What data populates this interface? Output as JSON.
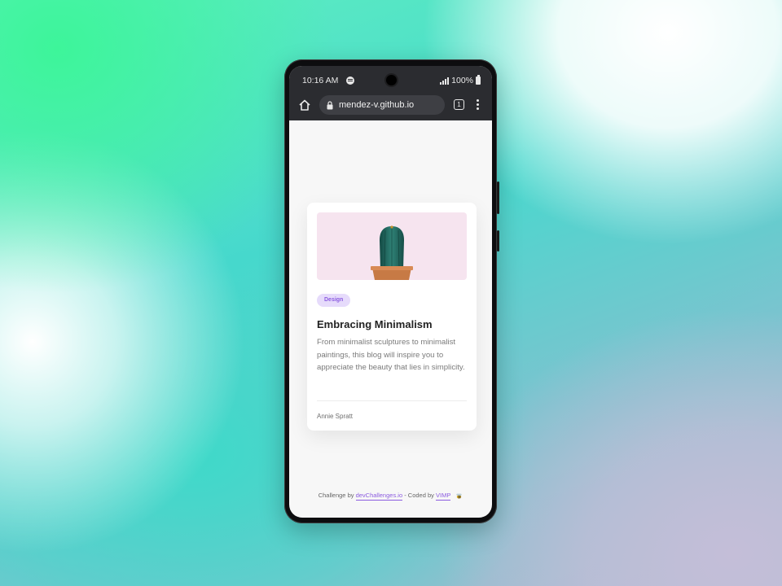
{
  "status_bar": {
    "time": "10:16 AM",
    "battery": "100%"
  },
  "browser": {
    "url": "mendez-v.github.io",
    "tab_count": "1"
  },
  "card": {
    "tag": "Design",
    "title": "Embracing Minimalism",
    "description": "From minimalist sculptures to minimalist paintings, this blog will inspire you to appreciate the beauty that lies in simplicity.",
    "author": "Annie Spratt"
  },
  "footer": {
    "prefix": "Challenge by",
    "challenge_link": "devChallenges.io",
    "middle": "- Coded by",
    "author_link": "VIMP"
  },
  "colors": {
    "accent": "#8c5ce0",
    "tag_bg": "#e6dbfb",
    "image_bg": "#f6e4ef",
    "browser_bar": "#2b2c30"
  }
}
